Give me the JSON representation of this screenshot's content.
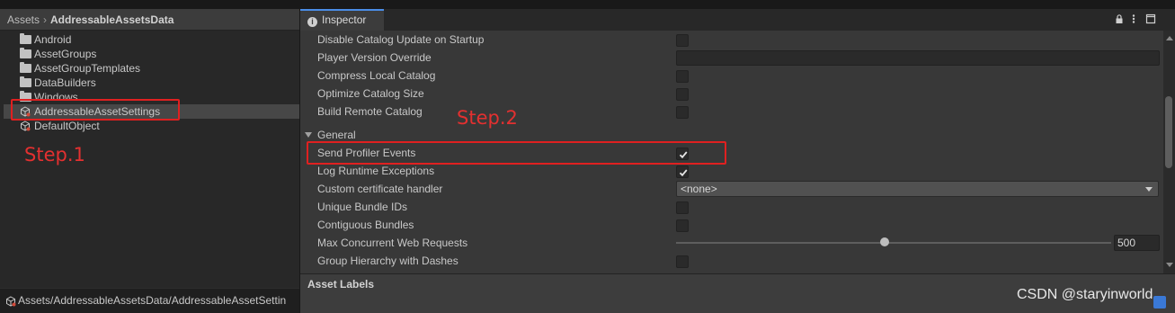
{
  "project": {
    "breadcrumb": [
      "Assets",
      "AddressableAssetsData"
    ],
    "breadcrumb_sep": "›",
    "items": [
      {
        "label": "Android",
        "icon": "folder-icon"
      },
      {
        "label": "AssetGroups",
        "icon": "folder-icon"
      },
      {
        "label": "AssetGroupTemplates",
        "icon": "folder-icon"
      },
      {
        "label": "DataBuilders",
        "icon": "folder-icon"
      },
      {
        "label": "Windows",
        "icon": "folder-icon"
      },
      {
        "label": "AddressableAssetSettings",
        "icon": "scriptable-object-icon",
        "selected": true
      },
      {
        "label": "DefaultObject",
        "icon": "scriptable-object-icon"
      }
    ],
    "footer_path": "Assets/AddressableAssetsData/AddressableAssetSettin"
  },
  "inspector": {
    "tab_label": "Inspector",
    "rows": [
      {
        "label": "Disable Catalog Update on Startup",
        "control": "checkbox",
        "checked": false
      },
      {
        "label": "Player Version Override",
        "control": "textfield",
        "value": ""
      },
      {
        "label": "Compress Local Catalog",
        "control": "checkbox",
        "checked": false
      },
      {
        "label": "Optimize Catalog Size",
        "control": "checkbox",
        "checked": false
      },
      {
        "label": "Build Remote Catalog",
        "control": "checkbox",
        "checked": false
      }
    ],
    "section_general": "General",
    "general_rows": [
      {
        "label": "Send Profiler Events",
        "control": "checkbox",
        "checked": true
      },
      {
        "label": "Log Runtime Exceptions",
        "control": "checkbox",
        "checked": true
      },
      {
        "label": "Custom certificate handler",
        "control": "dropdown",
        "value": "<none>"
      },
      {
        "label": "Unique Bundle IDs",
        "control": "checkbox",
        "checked": false
      },
      {
        "label": "Contiguous Bundles",
        "control": "checkbox",
        "checked": false
      },
      {
        "label": "Max Concurrent Web Requests",
        "control": "slider",
        "value": "500",
        "slider_fraction": 0.48
      },
      {
        "label": "Group Hierarchy with Dashes",
        "control": "checkbox",
        "checked": false
      }
    ],
    "asset_labels": "Asset Labels"
  },
  "annotations": {
    "step1": "Step.1",
    "step2": "Step.2"
  },
  "watermark": "CSDN @staryinworld",
  "colors": {
    "annotation_red": "#e02020",
    "tab_accent": "#4a8de6",
    "panel_bg": "#383838",
    "project_bg": "#282828"
  }
}
